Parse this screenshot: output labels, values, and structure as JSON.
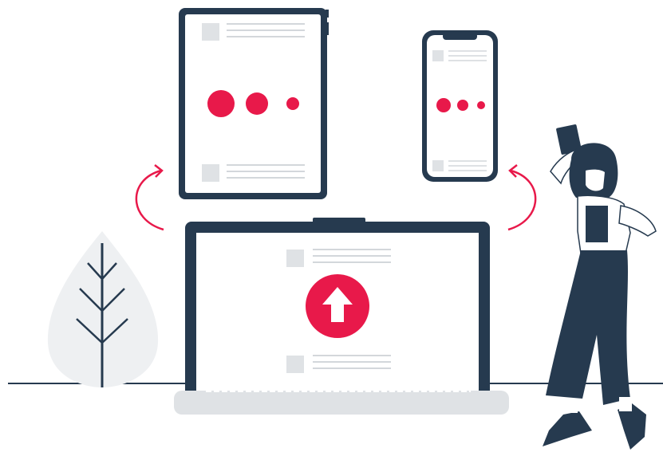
{
  "colors": {
    "accent": "#e8194a",
    "navy": "#263a4f",
    "light_gray": "#dfe2e5",
    "line_gray": "#d3d7db",
    "skin": "#ffffff"
  },
  "icons": {
    "upload": "arrow-up-icon",
    "sync_left": "curved-arrow-icon",
    "sync_right": "curved-arrow-icon"
  }
}
